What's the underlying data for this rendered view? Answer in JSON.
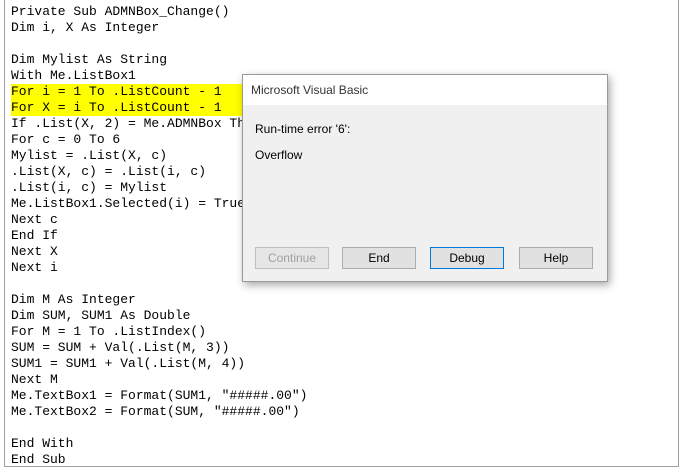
{
  "code": {
    "lines": [
      "Private Sub ADMNBox_Change()",
      "Dim i, X As Integer",
      "",
      "Dim Mylist As String",
      "With Me.ListBox1",
      "For i = 1 To .ListCount - 1",
      "For X = i To .ListCount - 1",
      "If .List(X, 2) = Me.ADMNBox Then",
      "For c = 0 To 6",
      "Mylist = .List(X, c)",
      ".List(X, c) = .List(i, c)",
      ".List(i, c) = Mylist",
      "Me.ListBox1.Selected(i) = True",
      "Next c",
      "End If",
      "Next X",
      "Next i",
      "",
      "Dim M As Integer",
      "Dim SUM, SUM1 As Double",
      "For M = 1 To .ListIndex()",
      "SUM = SUM + Val(.List(M, 3))",
      "SUM1 = SUM1 + Val(.List(M, 4))",
      "Next M",
      "Me.TextBox1 = Format(SUM1, \"#####.00\")",
      "Me.TextBox2 = Format(SUM, \"#####.00\")",
      "",
      "End With",
      "End Sub"
    ],
    "highlight_color": "#ffff00"
  },
  "dialog": {
    "title": "Microsoft Visual Basic",
    "message": "Run-time error '6':",
    "detail": "Overflow",
    "buttons": {
      "continue": "Continue",
      "end": "End",
      "debug": "Debug",
      "help": "Help"
    }
  }
}
